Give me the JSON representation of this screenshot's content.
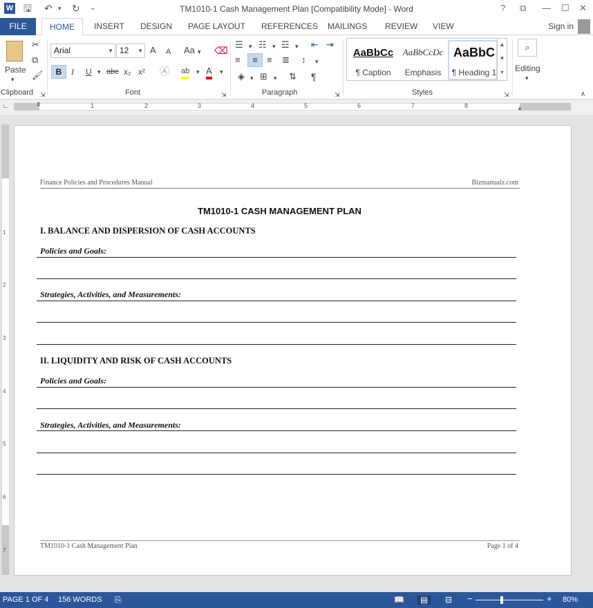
{
  "window": {
    "title": "TM1010-1 Cash Management Plan [Compatibility Mode] - Word",
    "app_logo": "W",
    "controls": [
      "?",
      "⧉",
      "—",
      "☐",
      "✕"
    ]
  },
  "tabs": {
    "file": "FILE",
    "items": [
      "HOME",
      "INSERT",
      "DESIGN",
      "PAGE LAYOUT",
      "REFERENCES",
      "MAILINGS",
      "REVIEW",
      "VIEW"
    ],
    "sign_in": "Sign in"
  },
  "ribbon": {
    "clipboard": {
      "paste": "Paste",
      "label": "Clipboard"
    },
    "font": {
      "label": "Font",
      "family": "Arial",
      "size": "12",
      "grow": "A",
      "shrink": "A",
      "change_case": "Aa",
      "bold": "B",
      "italic": "I",
      "underline": "U",
      "strike": "abc",
      "subscript": "x₂",
      "superscript": "x²"
    },
    "paragraph": {
      "label": "Paragraph"
    },
    "styles": {
      "label": "Styles",
      "items": [
        {
          "sample": "AaBbCc",
          "name": "¶ Caption"
        },
        {
          "sample": "AaBbCcDc",
          "name": "Emphasis"
        },
        {
          "sample": "AaBbC",
          "name": "¶ Heading 1"
        }
      ]
    },
    "editing": {
      "label": "Editing"
    }
  },
  "ruler": {
    "numbers": [
      "1",
      "2",
      "3",
      "4",
      "5",
      "6",
      "7",
      "8"
    ]
  },
  "vruler": {
    "numbers": [
      "1",
      "2",
      "3",
      "4",
      "5",
      "6",
      "7"
    ]
  },
  "document": {
    "header_left": "Finance Policies and Procedures Manual",
    "header_right": "Bizmanualz.com",
    "title": "TM1010-1 CASH MANAGEMENT PLAN",
    "sections": [
      {
        "heading": "I. BALANCE AND DISPERSION OF CASH ACCOUNTS",
        "policies": "Policies and Goals:",
        "strategies": "Strategies, Activities, and Measurements:"
      },
      {
        "heading": "II. LIQUIDITY AND RISK OF CASH ACCOUNTS",
        "policies": "Policies and Goals:",
        "strategies": "Strategies, Activities, and Measurements:"
      }
    ],
    "footer_left": "TM1010-1 Cash Management Plan",
    "footer_right": "Page 1 of 4"
  },
  "status": {
    "page": "PAGE 1 OF 4",
    "words": "156 WORDS",
    "zoom_minus": "−",
    "zoom_plus": "+",
    "zoom": "80%",
    "zoom_percent": 80
  },
  "colors": {
    "accent": "#2b579a",
    "selected": "#c5d9ef"
  }
}
